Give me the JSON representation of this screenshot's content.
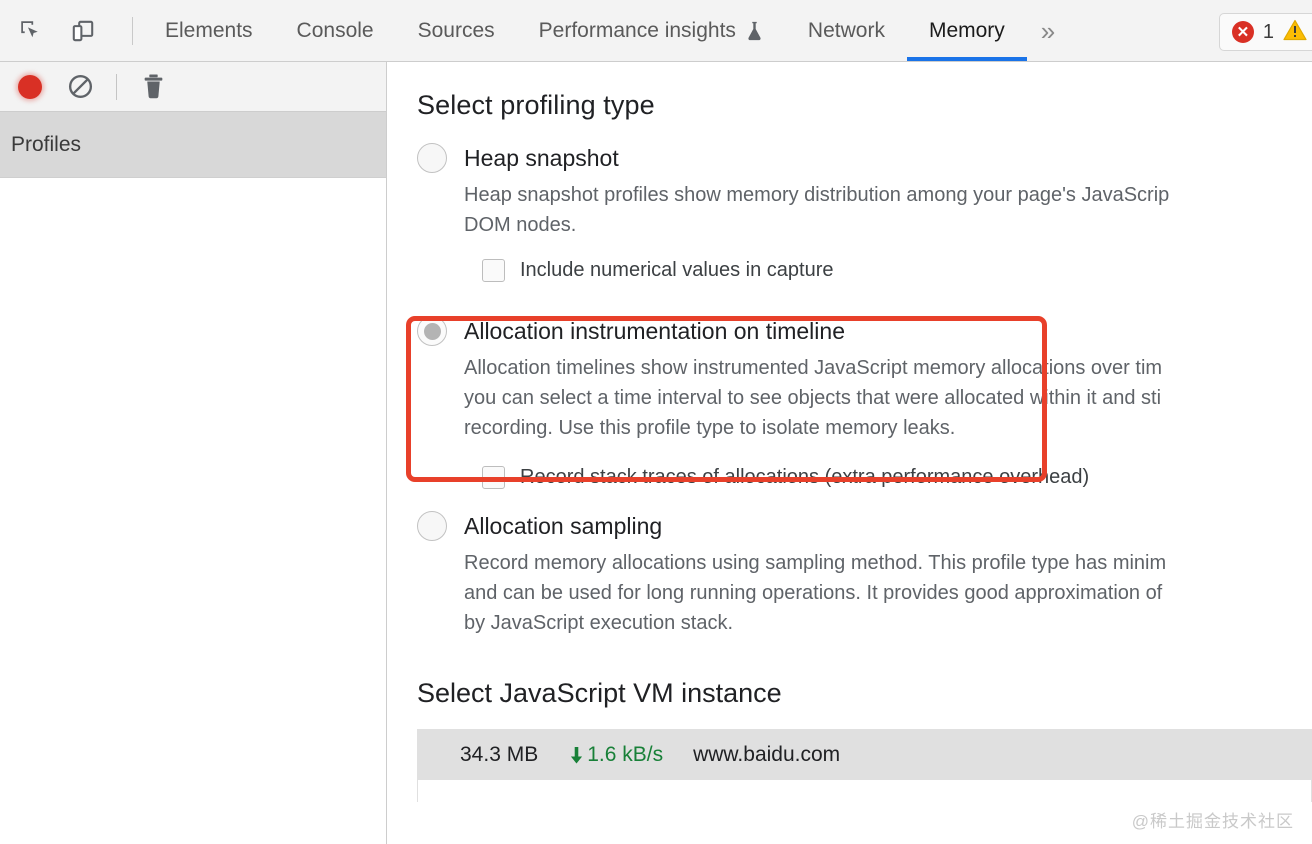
{
  "toolbar": {
    "inspect_icon": "inspect-cursor-icon",
    "device_icon": "device-toggle-icon",
    "tabs": [
      {
        "label": "Elements",
        "active": false
      },
      {
        "label": "Console",
        "active": false
      },
      {
        "label": "Sources",
        "active": false
      },
      {
        "label": "Performance insights",
        "active": false,
        "icon": "flask-icon"
      },
      {
        "label": "Network",
        "active": false
      },
      {
        "label": "Memory",
        "active": true
      }
    ],
    "more_tabs_label": "»",
    "issues": {
      "error_icon": "error-circle-icon",
      "error_count": "1",
      "warning_icon": "warning-triangle-icon"
    }
  },
  "sidebar": {
    "buttons": [
      {
        "name": "record-button",
        "icon": "record-circle-icon"
      },
      {
        "name": "clear-button",
        "icon": "no-entry-icon"
      },
      {
        "name": "delete-button",
        "icon": "trash-icon"
      }
    ],
    "section_label": "Profiles"
  },
  "main": {
    "profiling_title": "Select profiling type",
    "options": [
      {
        "id": "heap-snapshot",
        "label": "Heap snapshot",
        "selected": false,
        "description": "Heap snapshot profiles show memory distribution among your page's JavaScrip\nDOM nodes.",
        "checkbox": {
          "label": "Include numerical values in capture",
          "checked": false
        }
      },
      {
        "id": "allocation-instrumentation-on-timeline",
        "label": "Allocation instrumentation on timeline",
        "selected": true,
        "description": "Allocation timelines show instrumented JavaScript memory allocations over tim\nyou can select a time interval to see objects that were allocated within it and sti\nrecording. Use this profile type to isolate memory leaks.",
        "checkbox": {
          "label": "Record stack traces of allocations (extra performance overhead)",
          "checked": false
        }
      },
      {
        "id": "allocation-sampling",
        "label": "Allocation sampling",
        "selected": false,
        "description": "Record memory allocations using sampling method. This profile type has minim\nand can be used for long running operations. It provides good approximation of\nby JavaScript execution stack.",
        "checkbox": null
      }
    ],
    "vm_title": "Select JavaScript VM instance",
    "vm_rows": [
      {
        "size": "34.3 MB",
        "rate": "1.6 kB/s",
        "rate_icon": "download-arrow-icon",
        "origin": "www.baidu.com"
      }
    ]
  },
  "watermark": "@稀土掘金技术社区",
  "colors": {
    "accent_tab": "#1a73e8",
    "annotation": "#e8402a",
    "record": "#d93025",
    "rate_green": "#188038",
    "sidebar_selected": "#d8d8d8"
  }
}
